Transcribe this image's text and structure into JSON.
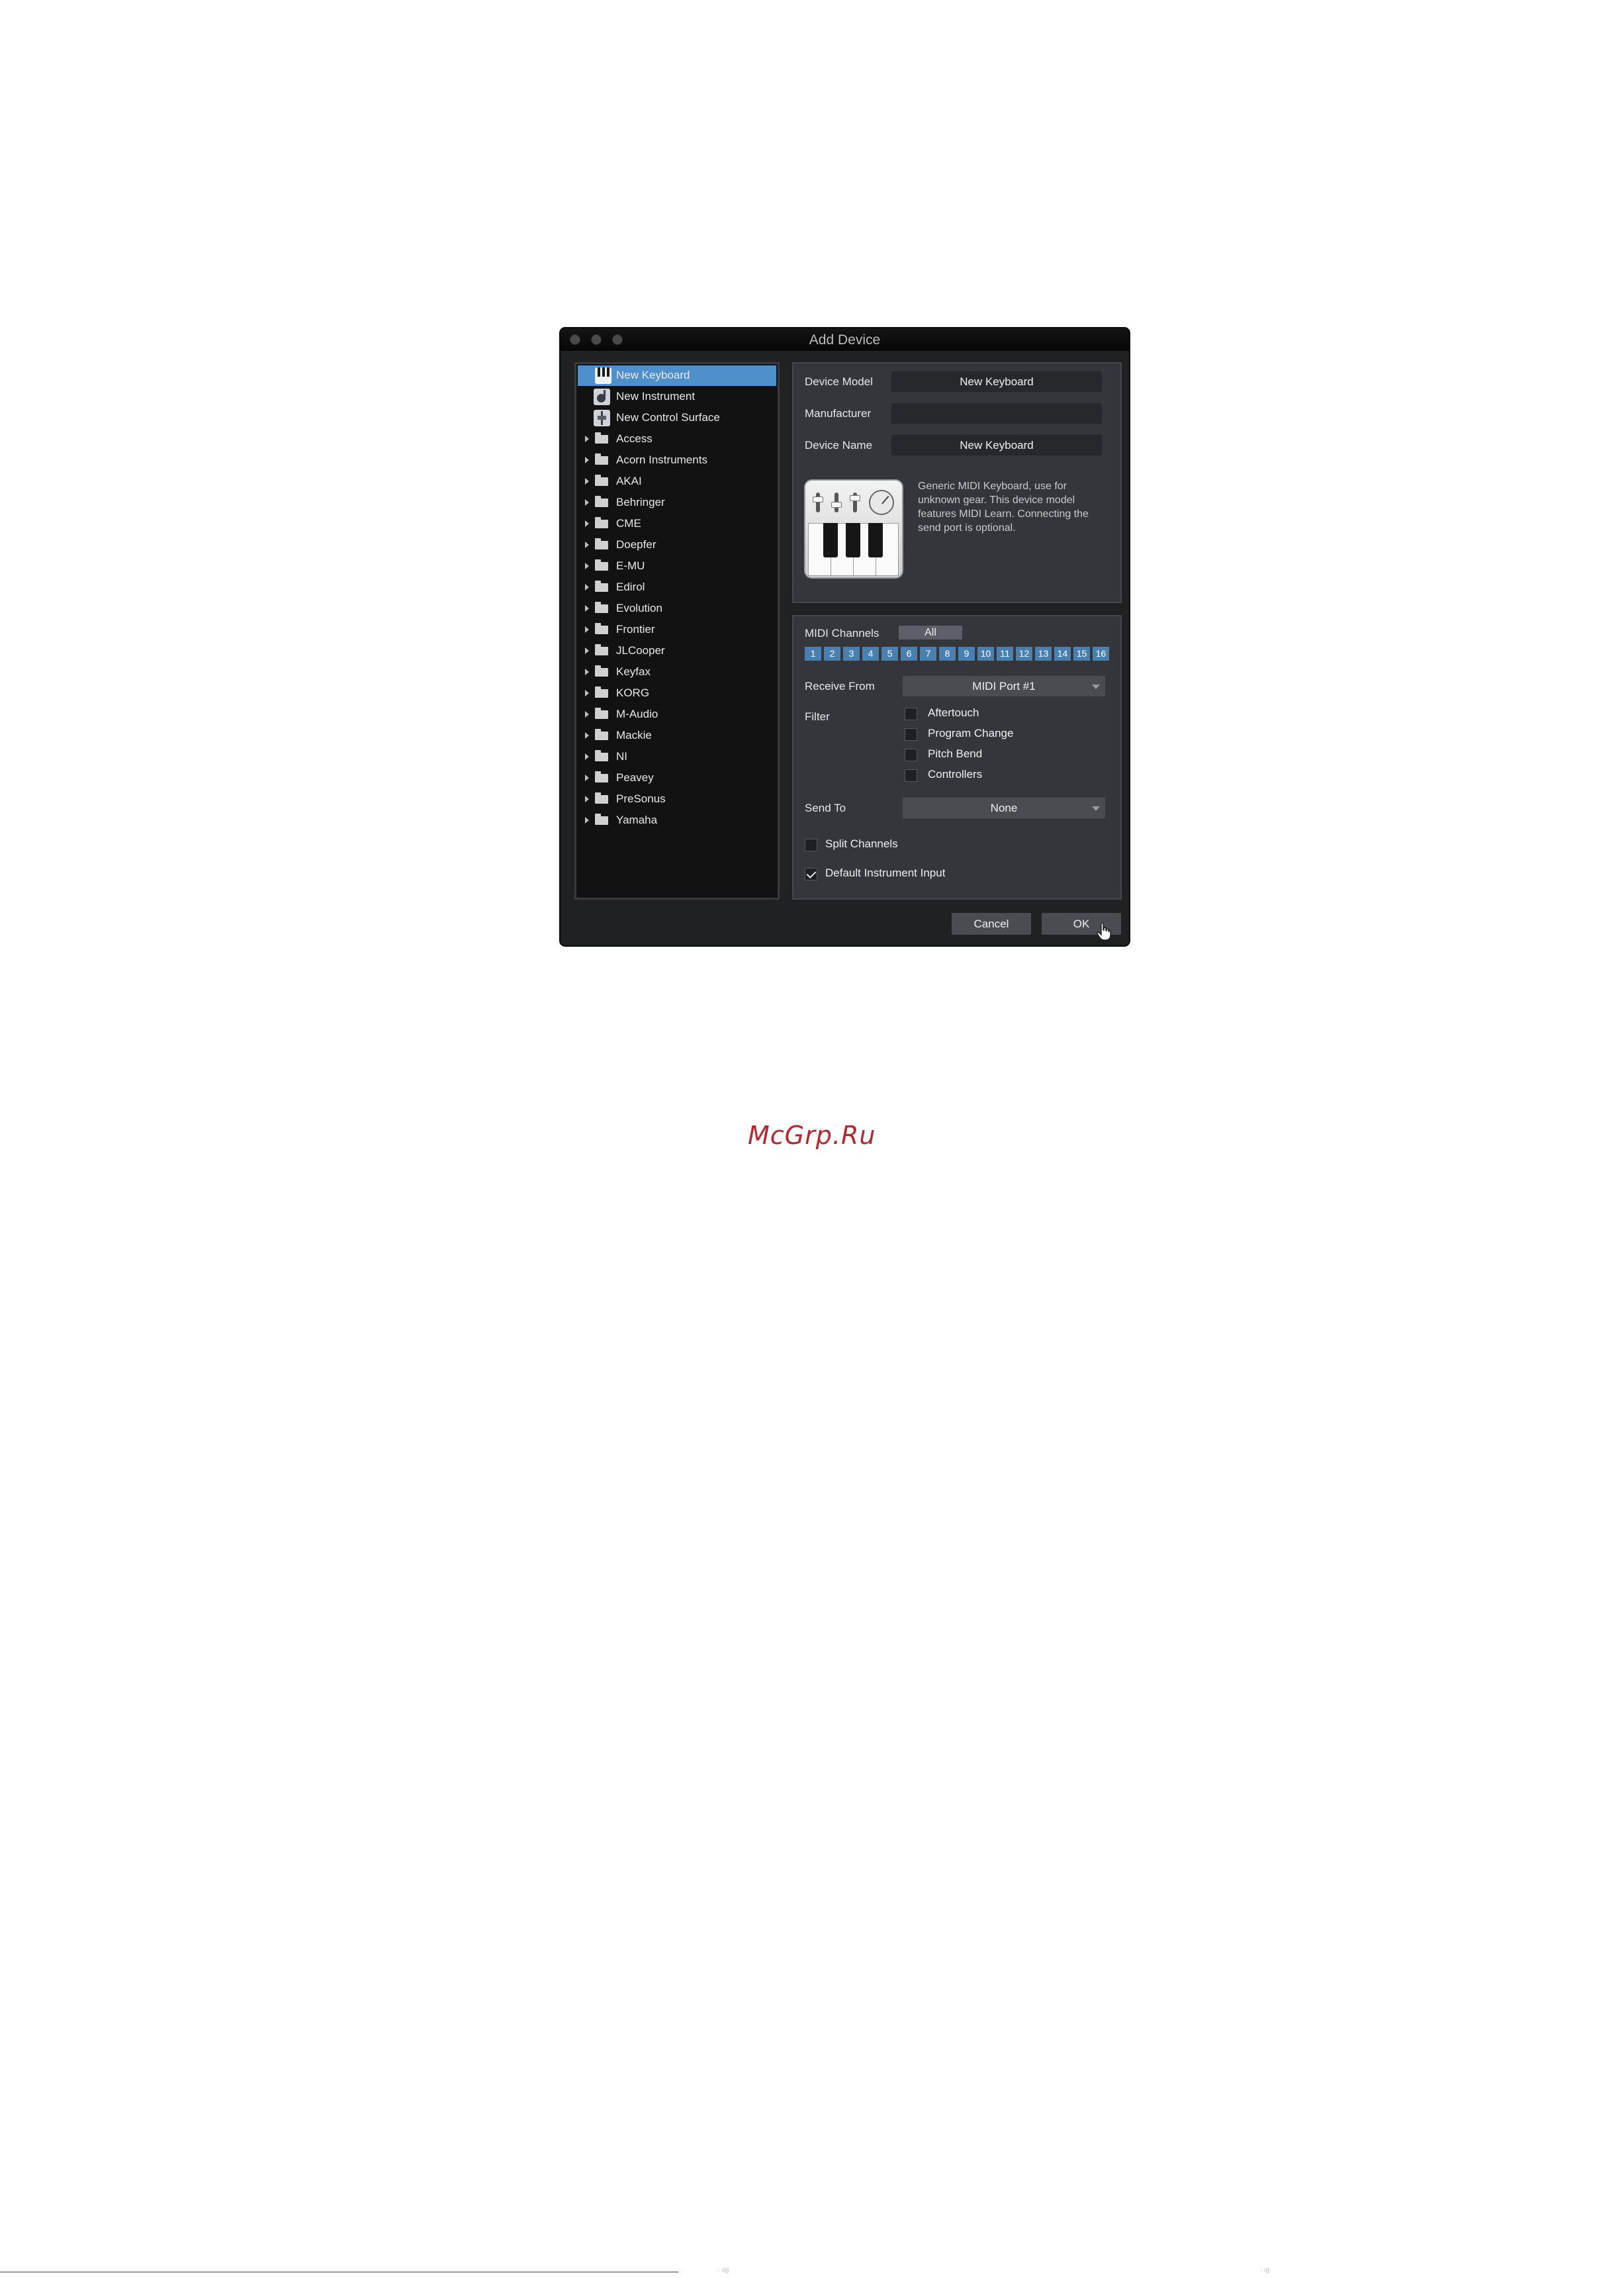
{
  "window": {
    "title": "Add Device"
  },
  "device_list": [
    {
      "label": "New Keyboard",
      "kind": "device",
      "icon": "keyboard-icon",
      "selected": true
    },
    {
      "label": "New Instrument",
      "kind": "device",
      "icon": "instrument-icon",
      "selected": false
    },
    {
      "label": "New Control Surface",
      "kind": "device",
      "icon": "control-surface-icon",
      "selected": false
    },
    {
      "label": "Access",
      "kind": "folder"
    },
    {
      "label": "Acorn Instruments",
      "kind": "folder"
    },
    {
      "label": "AKAI",
      "kind": "folder"
    },
    {
      "label": "Behringer",
      "kind": "folder"
    },
    {
      "label": "CME",
      "kind": "folder"
    },
    {
      "label": "Doepfer",
      "kind": "folder"
    },
    {
      "label": "E-MU",
      "kind": "folder"
    },
    {
      "label": "Edirol",
      "kind": "folder"
    },
    {
      "label": "Evolution",
      "kind": "folder"
    },
    {
      "label": "Frontier",
      "kind": "folder"
    },
    {
      "label": "JLCooper",
      "kind": "folder"
    },
    {
      "label": "Keyfax",
      "kind": "folder"
    },
    {
      "label": "KORG",
      "kind": "folder"
    },
    {
      "label": "M-Audio",
      "kind": "folder"
    },
    {
      "label": "Mackie",
      "kind": "folder"
    },
    {
      "label": "NI",
      "kind": "folder"
    },
    {
      "label": "Peavey",
      "kind": "folder"
    },
    {
      "label": "PreSonus",
      "kind": "folder"
    },
    {
      "label": "Yamaha",
      "kind": "folder"
    }
  ],
  "properties": {
    "device_model_label": "Device Model",
    "device_model_value": "New Keyboard",
    "manufacturer_label": "Manufacturer",
    "manufacturer_value": "",
    "device_name_label": "Device Name",
    "device_name_value": "New Keyboard",
    "description": "Generic MIDI Keyboard, use for unknown gear. This device model features MIDI Learn. Connecting the send port is optional."
  },
  "midi": {
    "channels_label": "MIDI Channels",
    "all_label": "All",
    "channels": [
      "1",
      "2",
      "3",
      "4",
      "5",
      "6",
      "7",
      "8",
      "9",
      "10",
      "11",
      "12",
      "13",
      "14",
      "15",
      "16"
    ],
    "receive_from_label": "Receive From",
    "receive_from_value": "MIDI Port #1",
    "filter_label": "Filter",
    "filters": [
      {
        "label": "Aftertouch",
        "checked": false
      },
      {
        "label": "Program Change",
        "checked": false
      },
      {
        "label": "Pitch Bend",
        "checked": false
      },
      {
        "label": "Controllers",
        "checked": false
      }
    ],
    "send_to_label": "Send To",
    "send_to_value": "None",
    "split_channels_label": "Split Channels",
    "split_channels_checked": false,
    "default_input_label": "Default Instrument Input",
    "default_input_checked": true
  },
  "buttons": {
    "cancel": "Cancel",
    "ok": "OK"
  },
  "watermark": "McGrp.Ru",
  "colors": {
    "selection": "#4f8fcb",
    "channel": "#4a7fae",
    "watermark": "#b5272d"
  }
}
